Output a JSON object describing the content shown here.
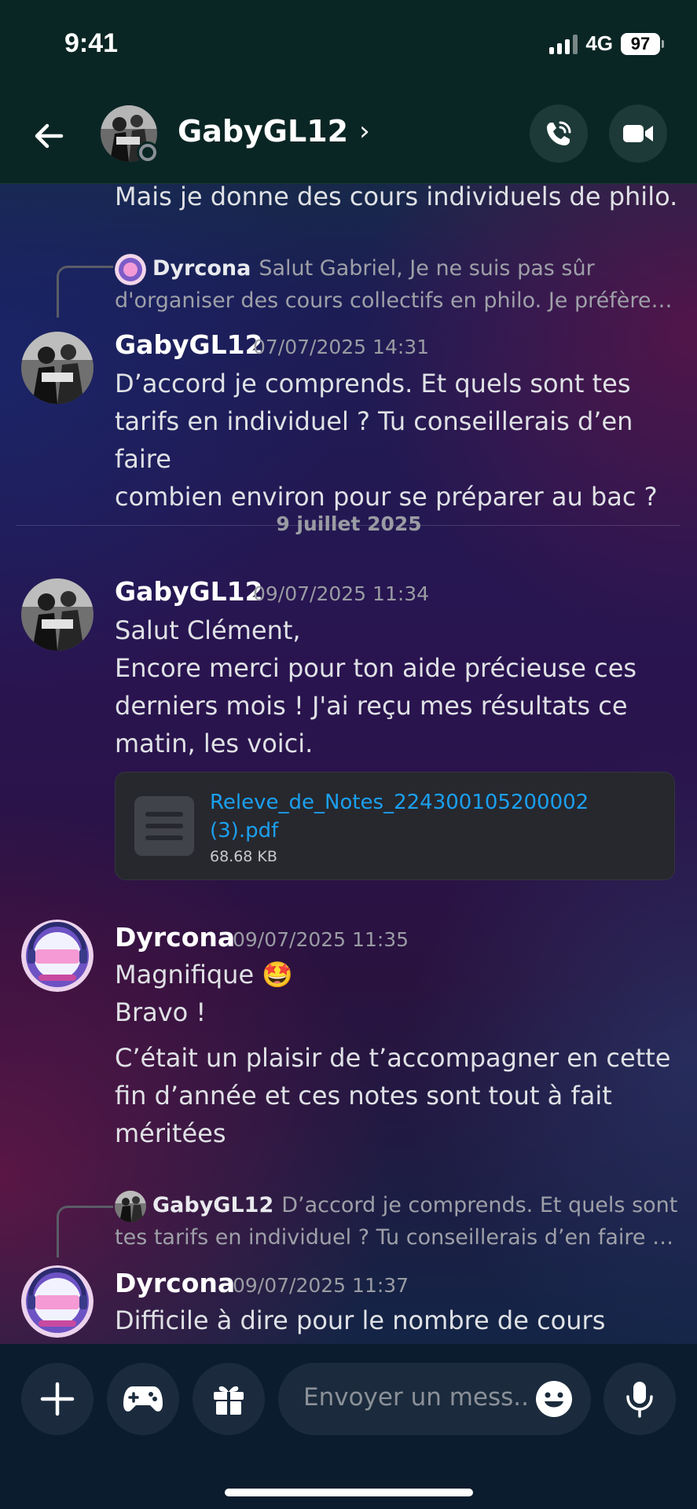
{
  "status": {
    "time": "9:41",
    "network": "4G",
    "battery": "97"
  },
  "header": {
    "title": "GabyGL12",
    "chevron": "›"
  },
  "messages": {
    "partial_top": "Mais je donne des cours individuels de philo.",
    "reply1": {
      "author": "Dyrcona",
      "line1": "Salut Gabriel,  Je ne suis pas sûr",
      "line2": "d'organiser des cours collectifs en philo. Je préfère…"
    },
    "m1": {
      "author": "GabyGL12",
      "time": "07/07/2025 14:31",
      "text": "D’accord je comprends. Et quels sont tes\ntarifs en individuel ? Tu conseillerais d’en faire\ncombien environ pour se préparer au bac ?"
    },
    "divider": "9 juillet 2025",
    "m2": {
      "author": "GabyGL12",
      "time": "09/07/2025 11:34",
      "text": "Salut Clément,\nEncore merci pour ton aide précieuse ces\nderniers mois ! J'ai reçu mes résultats ce\nmatin, les voici."
    },
    "file": {
      "name": "Releve_de_Notes_224300105200002\n(3).pdf",
      "size": "68.68 KB"
    },
    "m3": {
      "author": "Dyrcona",
      "time": "09/07/2025 11:35",
      "text_a": "Magnifique 🤩\nBravo !",
      "text_b": "C’était un plaisir de t’accompagner en cette\nfin d’année et ces notes sont tout à fait\nméritées"
    },
    "reply2": {
      "author": "GabyGL12",
      "line1": "D’accord je comprends. Et quels sont",
      "line2": "tes tarifs en individuel ? Tu conseillerais d’en faire …"
    },
    "m4": {
      "author": "Dyrcona",
      "time": "09/07/2025 11:37",
      "text": "Difficile à dire pour le nombre de cours"
    }
  },
  "composer": {
    "placeholder": "Envoyer un mess.."
  },
  "icons": [
    "back-arrow-icon",
    "presence-icon",
    "phone-call-icon",
    "video-camera-icon",
    "plus-icon",
    "gamepad-icon",
    "gift-icon",
    "emoji-icon",
    "microphone-icon",
    "file-icon"
  ],
  "colors": {
    "link": "#1ba0f0",
    "header_bg": "#0a2624",
    "composer_bg": "#0b1c2e"
  }
}
